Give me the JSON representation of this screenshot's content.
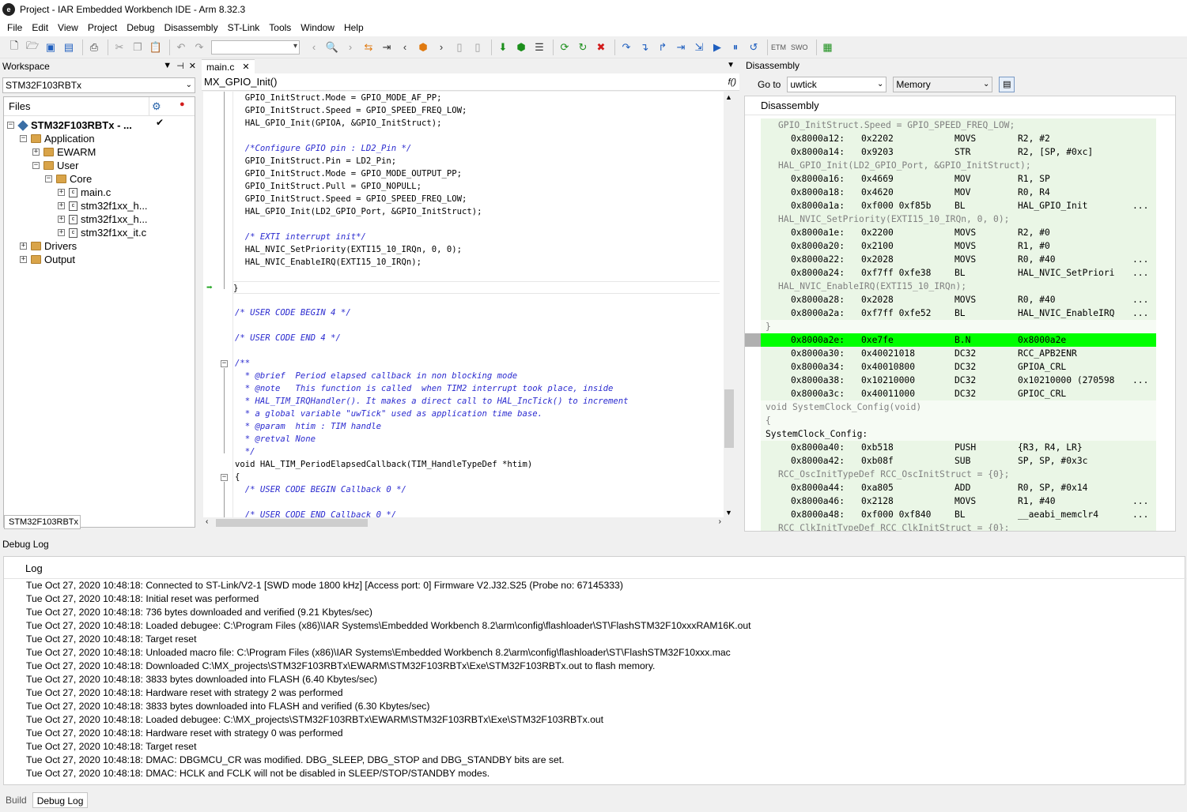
{
  "window": {
    "title": "Project - IAR Embedded Workbench IDE - Arm 8.32.3"
  },
  "menu": [
    "File",
    "Edit",
    "View",
    "Project",
    "Debug",
    "Disassembly",
    "ST-Link",
    "Tools",
    "Window",
    "Help"
  ],
  "toolbar": {
    "etm_label": "ETM",
    "swo_label": "SWO"
  },
  "workspace": {
    "title": "Workspace",
    "configuration": "STM32F103RBTx",
    "files_header": "Files",
    "tree": [
      {
        "label": "STM32F103RBTx - ...",
        "depth": 0,
        "type": "project",
        "toggle": "−"
      },
      {
        "label": "Application",
        "depth": 1,
        "type": "folder",
        "toggle": "−"
      },
      {
        "label": "EWARM",
        "depth": 2,
        "type": "folder",
        "toggle": "+"
      },
      {
        "label": "User",
        "depth": 2,
        "type": "folder",
        "toggle": "−"
      },
      {
        "label": "Core",
        "depth": 3,
        "type": "folder",
        "toggle": "−"
      },
      {
        "label": "main.c",
        "depth": 4,
        "type": "file",
        "toggle": "+"
      },
      {
        "label": "stm32f1xx_h...",
        "depth": 4,
        "type": "file",
        "toggle": "+"
      },
      {
        "label": "stm32f1xx_h...",
        "depth": 4,
        "type": "file",
        "toggle": "+"
      },
      {
        "label": "stm32f1xx_it.c",
        "depth": 4,
        "type": "file",
        "toggle": "+"
      },
      {
        "label": "Drivers",
        "depth": 1,
        "type": "folder",
        "toggle": "+"
      },
      {
        "label": "Output",
        "depth": 1,
        "type": "folder",
        "toggle": "+"
      }
    ],
    "bottom_tab": "STM32F103RBTx"
  },
  "editor": {
    "tab_label": "main.c",
    "function_bar": "MX_GPIO_Init()",
    "lines": [
      {
        "text": "  GPIO_InitStruct.Mode = GPIO_MODE_AF_PP;",
        "kind": "code"
      },
      {
        "text": "  GPIO_InitStruct.Speed = GPIO_SPEED_FREQ_LOW;",
        "kind": "code"
      },
      {
        "text": "  HAL_GPIO_Init(GPIOA, &GPIO_InitStruct);",
        "kind": "code"
      },
      {
        "text": "",
        "kind": "code"
      },
      {
        "text": "  /*Configure GPIO pin : LD2_Pin */",
        "kind": "comment"
      },
      {
        "text": "  GPIO_InitStruct.Pin = LD2_Pin;",
        "kind": "code"
      },
      {
        "text": "  GPIO_InitStruct.Mode = GPIO_MODE_OUTPUT_PP;",
        "kind": "code"
      },
      {
        "text": "  GPIO_InitStruct.Pull = GPIO_NOPULL;",
        "kind": "code"
      },
      {
        "text": "  GPIO_InitStruct.Speed = GPIO_SPEED_FREQ_LOW;",
        "kind": "code"
      },
      {
        "text": "  HAL_GPIO_Init(LD2_GPIO_Port, &GPIO_InitStruct);",
        "kind": "code"
      },
      {
        "text": "",
        "kind": "code"
      },
      {
        "text": "  /* EXTI interrupt init*/",
        "kind": "comment"
      },
      {
        "text": "  HAL_NVIC_SetPriority(EXTI15_10_IRQn, 0, 0);",
        "kind": "code"
      },
      {
        "text": "  HAL_NVIC_EnableIRQ(EXTI15_10_IRQn);",
        "kind": "code"
      },
      {
        "text": "",
        "kind": "code"
      },
      {
        "text": "}",
        "kind": "cursor"
      },
      {
        "text": "",
        "kind": "code"
      },
      {
        "text": "/* USER CODE BEGIN 4 */",
        "kind": "comment"
      },
      {
        "text": "",
        "kind": "code"
      },
      {
        "text": "/* USER CODE END 4 */",
        "kind": "comment"
      },
      {
        "text": "",
        "kind": "code"
      },
      {
        "text": "/**",
        "kind": "comment"
      },
      {
        "text": "  * @brief  Period elapsed callback in non blocking mode",
        "kind": "comment"
      },
      {
        "text": "  * @note   This function is called  when TIM2 interrupt took place, inside",
        "kind": "comment"
      },
      {
        "text": "  * HAL_TIM_IRQHandler(). It makes a direct call to HAL_IncTick() to increment",
        "kind": "comment"
      },
      {
        "text": "  * a global variable \"uwTick\" used as application time base.",
        "kind": "comment"
      },
      {
        "text": "  * @param  htim : TIM handle",
        "kind": "comment"
      },
      {
        "text": "  * @retval None",
        "kind": "comment"
      },
      {
        "text": "  */",
        "kind": "comment"
      },
      {
        "text": "void HAL_TIM_PeriodElapsedCallback(TIM_HandleTypeDef *htim)",
        "kind": "code"
      },
      {
        "text": "{",
        "kind": "code"
      },
      {
        "text": "  /* USER CODE BEGIN Callback 0 */",
        "kind": "comment"
      },
      {
        "text": "",
        "kind": "code"
      },
      {
        "text": "  /* USER CODE END Callback 0 */",
        "kind": "comment"
      }
    ]
  },
  "disassembly": {
    "title": "Disassembly",
    "goto_label": "Go to",
    "goto_value": "uwtick",
    "memory_combo": "Memory",
    "header": "Disassembly",
    "rows": [
      {
        "kind": "src",
        "text": "GPIO_InitStruct.Speed = GPIO_SPEED_FREQ_LOW;"
      },
      {
        "kind": "ins",
        "addr": "0x8000a12:",
        "code": "0x2202",
        "mnem": "MOVS",
        "ops": "R2, #2",
        "more": ""
      },
      {
        "kind": "ins",
        "addr": "0x8000a14:",
        "code": "0x9203",
        "mnem": "STR",
        "ops": "R2, [SP, #0xc]",
        "more": ""
      },
      {
        "kind": "src",
        "text": "HAL_GPIO_Init(LD2_GPIO_Port, &GPIO_InitStruct);"
      },
      {
        "kind": "ins",
        "addr": "0x8000a16:",
        "code": "0x4669",
        "mnem": "MOV",
        "ops": "R1, SP",
        "more": ""
      },
      {
        "kind": "ins",
        "addr": "0x8000a18:",
        "code": "0x4620",
        "mnem": "MOV",
        "ops": "R0, R4",
        "more": ""
      },
      {
        "kind": "ins",
        "addr": "0x8000a1a:",
        "code": "0xf000 0xf85b",
        "mnem": "BL",
        "ops": "HAL_GPIO_Init",
        "more": "..."
      },
      {
        "kind": "src",
        "text": "HAL_NVIC_SetPriority(EXTI15_10_IRQn, 0, 0);"
      },
      {
        "kind": "ins",
        "addr": "0x8000a1e:",
        "code": "0x2200",
        "mnem": "MOVS",
        "ops": "R2, #0",
        "more": ""
      },
      {
        "kind": "ins",
        "addr": "0x8000a20:",
        "code": "0x2100",
        "mnem": "MOVS",
        "ops": "R1, #0",
        "more": ""
      },
      {
        "kind": "ins",
        "addr": "0x8000a22:",
        "code": "0x2028",
        "mnem": "MOVS",
        "ops": "R0, #40",
        "more": "..."
      },
      {
        "kind": "ins",
        "addr": "0x8000a24:",
        "code": "0xf7ff 0xfe38",
        "mnem": "BL",
        "ops": "HAL_NVIC_SetPriori",
        "more": "..."
      },
      {
        "kind": "src",
        "text": "HAL_NVIC_EnableIRQ(EXTI15_10_IRQn);"
      },
      {
        "kind": "ins",
        "addr": "0x8000a28:",
        "code": "0x2028",
        "mnem": "MOVS",
        "ops": "R0, #40",
        "more": "..."
      },
      {
        "kind": "ins",
        "addr": "0x8000a2a:",
        "code": "0xf7ff 0xfe52",
        "mnem": "BL",
        "ops": "HAL_NVIC_EnableIRQ",
        "more": "..."
      },
      {
        "kind": "brace",
        "text": "}"
      },
      {
        "kind": "hl",
        "addr": "0x8000a2e:",
        "code": "0xe7fe",
        "mnem": "B.N",
        "ops": "0x8000a2e",
        "more": ""
      },
      {
        "kind": "ins",
        "addr": "0x8000a30:",
        "code": "0x40021018",
        "mnem": "DC32",
        "ops": "RCC_APB2ENR",
        "more": ""
      },
      {
        "kind": "ins",
        "addr": "0x8000a34:",
        "code": "0x40010800",
        "mnem": "DC32",
        "ops": "GPIOA_CRL",
        "more": ""
      },
      {
        "kind": "ins",
        "addr": "0x8000a38:",
        "code": "0x10210000",
        "mnem": "DC32",
        "ops": "0x10210000 (270598",
        "more": "..."
      },
      {
        "kind": "ins",
        "addr": "0x8000a3c:",
        "code": "0x40011000",
        "mnem": "DC32",
        "ops": "GPIOC_CRL",
        "more": ""
      },
      {
        "kind": "srcdark",
        "text": "void SystemClock_Config(void)"
      },
      {
        "kind": "srcdark",
        "text": "{"
      },
      {
        "kind": "label",
        "text": "SystemClock_Config:"
      },
      {
        "kind": "ins",
        "addr": "0x8000a40:",
        "code": "0xb518",
        "mnem": "PUSH",
        "ops": "{R3, R4, LR}",
        "more": ""
      },
      {
        "kind": "ins",
        "addr": "0x8000a42:",
        "code": "0xb08f",
        "mnem": "SUB",
        "ops": "SP, SP, #0x3c",
        "more": ""
      },
      {
        "kind": "src",
        "text": "RCC_OscInitTypeDef RCC_OscInitStruct = {0};"
      },
      {
        "kind": "ins",
        "addr": "0x8000a44:",
        "code": "0xa805",
        "mnem": "ADD",
        "ops": "R0, SP, #0x14",
        "more": ""
      },
      {
        "kind": "ins",
        "addr": "0x8000a46:",
        "code": "0x2128",
        "mnem": "MOVS",
        "ops": "R1, #40",
        "more": "..."
      },
      {
        "kind": "ins",
        "addr": "0x8000a48:",
        "code": "0xf000 0xf840",
        "mnem": "BL",
        "ops": "__aeabi_memclr4",
        "more": "..."
      },
      {
        "kind": "src",
        "text": "RCC_ClkInitTypeDef RCC_ClkInitStruct = {0};"
      }
    ]
  },
  "debug_log": {
    "title": "Debug Log",
    "header": "Log",
    "lines": [
      "Tue Oct 27, 2020 10:48:18: Connected to ST-Link/V2-1 [SWD mode 1800 kHz] [Access port: 0] Firmware V2.J32.S25 (Probe no: 67145333)",
      "Tue Oct 27, 2020 10:48:18: Initial reset was performed",
      "Tue Oct 27, 2020 10:48:18: 736 bytes downloaded and verified (9.21 Kbytes/sec)",
      "Tue Oct 27, 2020 10:48:18: Loaded debugee: C:\\Program Files (x86)\\IAR Systems\\Embedded Workbench 8.2\\arm\\config\\flashloader\\ST\\FlashSTM32F10xxxRAM16K.out",
      "Tue Oct 27, 2020 10:48:18: Target reset",
      "Tue Oct 27, 2020 10:48:18: Unloaded macro file: C:\\Program Files (x86)\\IAR Systems\\Embedded Workbench 8.2\\arm\\config\\flashloader\\ST\\FlashSTM32F10xxx.mac",
      "Tue Oct 27, 2020 10:48:18: Downloaded C:\\MX_projects\\STM32F103RBTx\\EWARM\\STM32F103RBTx\\Exe\\STM32F103RBTx.out to flash memory.",
      "Tue Oct 27, 2020 10:48:18: 3833 bytes downloaded into FLASH (6.40 Kbytes/sec)",
      "Tue Oct 27, 2020 10:48:18: Hardware reset with strategy 2 was performed",
      "Tue Oct 27, 2020 10:48:18: 3833 bytes downloaded into FLASH and verified (6.30 Kbytes/sec)",
      "Tue Oct 27, 2020 10:48:18: Loaded debugee: C:\\MX_projects\\STM32F103RBTx\\EWARM\\STM32F103RBTx\\Exe\\STM32F103RBTx.out",
      "Tue Oct 27, 2020 10:48:18: Hardware reset with strategy 0 was performed",
      "Tue Oct 27, 2020 10:48:18: Target reset",
      "Tue Oct 27, 2020 10:48:18: DMAC: DBGMCU_CR was modified. DBG_SLEEP, DBG_STOP and DBG_STANDBY bits are set.",
      "Tue Oct 27, 2020 10:48:18: DMAC: HCLK and FCLK will not be disabled in SLEEP/STOP/STANDBY modes."
    ]
  },
  "bottom_tabs": [
    "Build",
    "Debug Log"
  ]
}
